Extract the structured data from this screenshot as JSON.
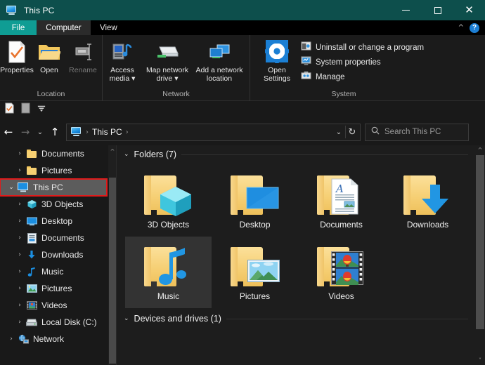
{
  "window": {
    "title": "This PC",
    "icon": "this-pc-icon",
    "controls": {
      "minimize": "–",
      "maximize": "□",
      "close": "✕"
    }
  },
  "ribbon": {
    "tabs": [
      {
        "id": "file",
        "label": "File",
        "state": "file"
      },
      {
        "id": "computer",
        "label": "Computer",
        "state": "active"
      },
      {
        "id": "view",
        "label": "View",
        "state": "normal"
      }
    ],
    "collapse_icon": "chevron-up-icon",
    "help_icon": "help-question-icon",
    "groups": [
      {
        "id": "location",
        "label": "Location",
        "buttons": [
          {
            "label": "Properties",
            "icon": "properties-icon",
            "enabled": true
          },
          {
            "label": "Open",
            "icon": "open-folder-icon",
            "enabled": true
          },
          {
            "label": "Rename",
            "icon": "rename-icon",
            "enabled": false
          }
        ]
      },
      {
        "id": "network",
        "label": "Network",
        "buttons": [
          {
            "label": "Access media ▾",
            "icon": "access-media-icon",
            "enabled": true
          },
          {
            "label": "Map network drive ▾",
            "icon": "map-network-drive-icon",
            "enabled": true
          },
          {
            "label": "Add a network location",
            "icon": "add-network-location-icon",
            "enabled": true
          }
        ]
      },
      {
        "id": "system",
        "label": "System",
        "big_button": {
          "label_line1": "Open",
          "label_line2": "Settings",
          "icon": "gear-icon"
        },
        "items": [
          {
            "label": "Uninstall or change a program",
            "icon": "uninstall-icon"
          },
          {
            "label": "System properties",
            "icon": "system-properties-icon"
          },
          {
            "label": "Manage",
            "icon": "manage-icon"
          }
        ]
      }
    ]
  },
  "quick_access": {
    "items": [
      {
        "icon": "properties-small-icon",
        "name": "qat-properties"
      },
      {
        "icon": "new-folder-small-icon",
        "name": "qat-new-folder"
      },
      {
        "icon": "customize-dropdown-icon",
        "name": "qat-customize"
      }
    ]
  },
  "address_bar": {
    "back": "←",
    "forward": "→",
    "recent": "⌄",
    "up": "↑",
    "breadcrumb_icon": "this-pc-icon",
    "breadcrumb": [
      "This PC"
    ],
    "dropdown": "⌄",
    "refresh": "↻",
    "search": {
      "icon": "search-icon",
      "placeholder": "Search This PC",
      "value": ""
    }
  },
  "nav_pane": {
    "scroll_up_icon": "chevron-up-icon",
    "items": [
      {
        "label": "Documents",
        "icon": "folder-icon",
        "expander": "›",
        "indent": 1,
        "selected": false
      },
      {
        "label": "Pictures",
        "icon": "folder-icon",
        "expander": "›",
        "indent": 1,
        "selected": false
      },
      {
        "label": "This PC",
        "icon": "this-pc-icon",
        "expander": "⌄",
        "indent": 0,
        "selected": true
      },
      {
        "label": "3D Objects",
        "icon": "3d-objects-icon",
        "expander": "›",
        "indent": 1,
        "selected": false
      },
      {
        "label": "Desktop",
        "icon": "desktop-icon",
        "expander": "›",
        "indent": 1,
        "selected": false
      },
      {
        "label": "Documents",
        "icon": "documents-icon",
        "expander": "›",
        "indent": 1,
        "selected": false
      },
      {
        "label": "Downloads",
        "icon": "downloads-icon",
        "expander": "›",
        "indent": 1,
        "selected": false
      },
      {
        "label": "Music",
        "icon": "music-icon",
        "expander": "›",
        "indent": 1,
        "selected": false
      },
      {
        "label": "Pictures",
        "icon": "pictures-icon",
        "expander": "›",
        "indent": 1,
        "selected": false
      },
      {
        "label": "Videos",
        "icon": "videos-icon",
        "expander": "›",
        "indent": 1,
        "selected": false
      },
      {
        "label": "Local Disk (C:)",
        "icon": "local-disk-icon",
        "expander": "›",
        "indent": 1,
        "selected": false
      },
      {
        "label": "Network",
        "icon": "network-icon",
        "expander": "›",
        "indent": 0,
        "selected": false
      }
    ]
  },
  "content": {
    "sections": [
      {
        "id": "folders",
        "header": "Folders (7)",
        "chevron": "⌄",
        "tiles": [
          {
            "label": "3D Objects",
            "icon": "3d-objects-folder-icon",
            "selected": false
          },
          {
            "label": "Desktop",
            "icon": "desktop-folder-icon",
            "selected": false
          },
          {
            "label": "Documents",
            "icon": "documents-folder-icon",
            "selected": false
          },
          {
            "label": "Downloads",
            "icon": "downloads-folder-icon",
            "selected": false
          },
          {
            "label": "Music",
            "icon": "music-folder-icon",
            "selected": true
          },
          {
            "label": "Pictures",
            "icon": "pictures-folder-icon",
            "selected": false
          },
          {
            "label": "Videos",
            "icon": "videos-folder-icon",
            "selected": false
          }
        ]
      },
      {
        "id": "devices",
        "header": "Devices and drives (1)",
        "chevron": "⌄",
        "tiles": []
      }
    ],
    "scroll_up_icon": "chevron-up-icon",
    "scroll_down_icon": "chevron-down-icon"
  },
  "colors": {
    "titlebar": "#0d4f4c",
    "file_tab": "#0f9d94",
    "selection_highlight": "#5c5c5c",
    "selection_outline": "#e01b1b",
    "tile_selected": "#333333",
    "folder_yellow": "#f6cf74",
    "accent_blue": "#1b8ee0"
  }
}
